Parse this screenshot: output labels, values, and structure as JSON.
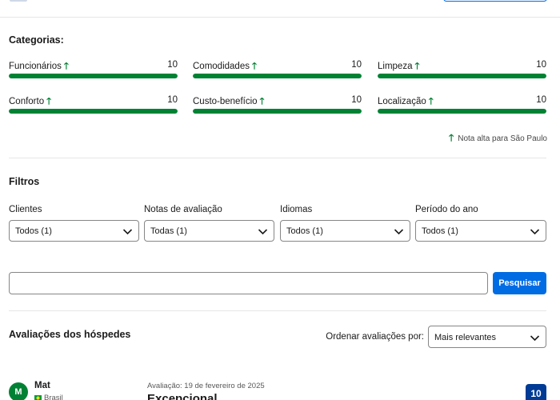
{
  "categories": {
    "title": "Categorias:",
    "items": [
      {
        "name": "Funcionários",
        "score": "10",
        "fill": 1.0
      },
      {
        "name": "Comodidades",
        "score": "10",
        "fill": 1.0
      },
      {
        "name": "Limpeza",
        "score": "10",
        "fill": 1.0
      },
      {
        "name": "Conforto",
        "score": "10",
        "fill": 1.0
      },
      {
        "name": "Custo-benefício",
        "score": "10",
        "fill": 1.0
      },
      {
        "name": "Localização",
        "score": "10",
        "fill": 1.0
      }
    ],
    "arrow_glyph": "🡑",
    "note": "Nota alta para São Paulo"
  },
  "filters": {
    "title": "Filtros",
    "items": [
      {
        "label": "Clientes",
        "value": "Todos (1)"
      },
      {
        "label": "Notas de avaliação",
        "value": "Todas (1)"
      },
      {
        "label": "Idiomas",
        "value": "Todos (1)"
      },
      {
        "label": "Período do ano",
        "value": "Todos (1)"
      }
    ]
  },
  "search": {
    "placeholder": "",
    "value": "",
    "button_label": "Pesquisar"
  },
  "reviews": {
    "title": "Avaliações dos hóspedes",
    "sort_label": "Ordenar avaliações por:",
    "sort_value": "Mais relevantes",
    "first": {
      "avatar_initial": "M",
      "name": "Mat",
      "country": "Brasil",
      "date": "Avaliação: 19 de fevereiro de 2025",
      "title": "Excepcional",
      "score": "10"
    }
  },
  "colors": {
    "bar": "#008234",
    "accent": "#006ce4",
    "badge": "#003b95"
  }
}
